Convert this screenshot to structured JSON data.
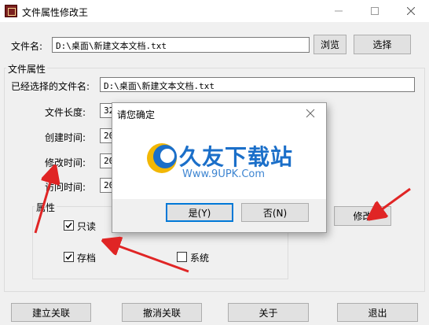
{
  "window": {
    "title": "文件属性修改王"
  },
  "top": {
    "filename_label": "文件名:",
    "filename_value": "D:\\桌面\\新建文本文档.txt",
    "browse_label": "浏览",
    "select_label": "选择"
  },
  "props": {
    "group_title": "文件属性",
    "selected_label": "已经选择的文件名:",
    "selected_value": "D:\\桌面\\新建文本文档.txt",
    "length_label": "文件长度:",
    "length_value": "32",
    "created_label": "创建时间:",
    "created_value": "20",
    "modified_label": "修改时间:",
    "modified_value": "20",
    "accessed_label": "访问时间:",
    "accessed_value": "20"
  },
  "attrs": {
    "group_title": "属性",
    "readonly_label": "只读",
    "readonly_checked": true,
    "archive_label": "存档",
    "archive_checked": true,
    "system_label": "系统",
    "system_checked": false
  },
  "modify_label": "修改",
  "bottom": {
    "associate_label": "建立关联",
    "unassociate_label": "撤消关联",
    "about_label": "关于",
    "exit_label": "退出"
  },
  "dialog": {
    "title": "请您确定",
    "yes_label": "是(Y)",
    "no_label": "否(N)"
  },
  "watermark": {
    "brand": "久友下载站",
    "url": "Www.9UPK.Com"
  },
  "colors": {
    "accent": "#0078d7",
    "arrow": "#e02525"
  }
}
